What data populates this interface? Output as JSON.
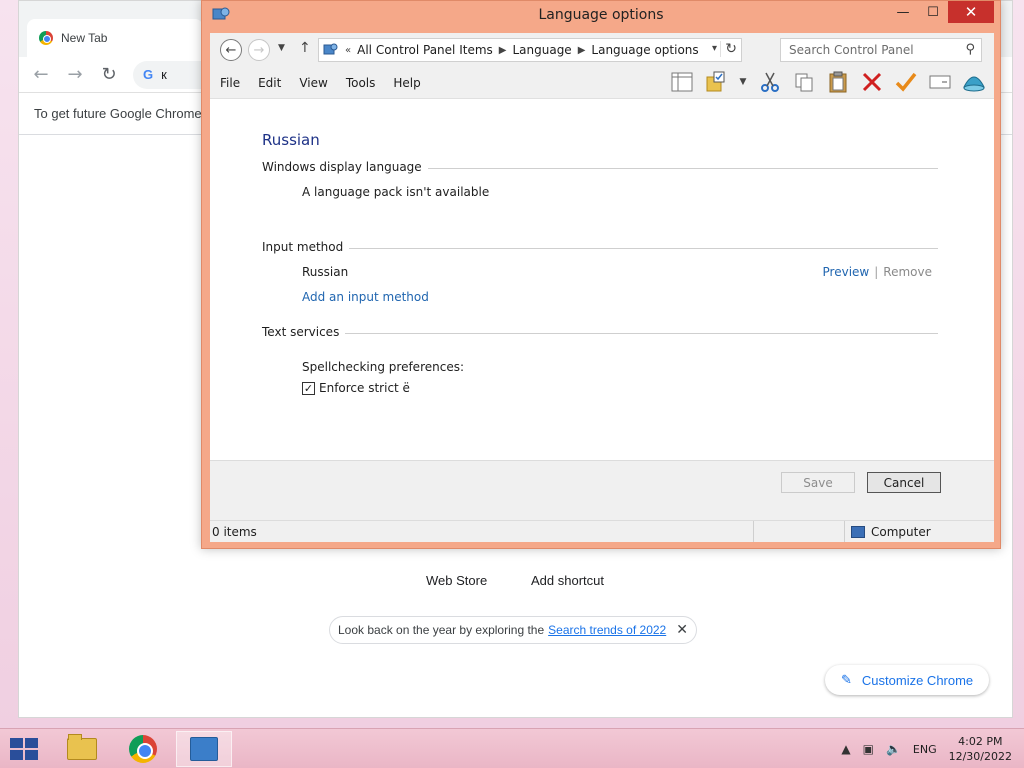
{
  "chrome": {
    "tab_title": "New Tab",
    "omnibox_text": "к",
    "infobar_text": "To get future Google Chrome",
    "ntp_links": [
      "Web Store",
      "Add shortcut"
    ],
    "trend_prefix": "Look back on the year by exploring the ",
    "trend_link": "Search trends of 2022",
    "customize_label": "Customize Chrome"
  },
  "window": {
    "title": "Language options",
    "caption": {
      "minimize": "—",
      "maximize": "☐",
      "close": "✕"
    },
    "address": {
      "overflow": "«",
      "crumbs": [
        "All Control Panel Items",
        "Language",
        "Language options"
      ]
    },
    "search_placeholder": "Search Control Panel",
    "menu": [
      "File",
      "Edit",
      "View",
      "Tools",
      "Help"
    ],
    "toolbar_icons": [
      "layout-icon",
      "properties-folder-icon",
      "cut-icon",
      "copy-icon",
      "paste-icon",
      "delete-icon",
      "check-icon",
      "rename-icon",
      "globe-icon"
    ]
  },
  "content": {
    "language_name": "Russian",
    "sections": {
      "display_language": "Windows display language",
      "input_method": "Input method",
      "text_services": "Text services"
    },
    "display_language_status": "A language pack isn't available",
    "input_method_name": "Russian",
    "preview_label": "Preview",
    "remove_label": "Remove",
    "add_input_label": "Add an input method",
    "spell_label": "Spellchecking preferences:",
    "checkbox_label": "Enforce strict ё",
    "checkbox_checked": true
  },
  "buttons": {
    "save": "Save",
    "cancel": "Cancel"
  },
  "status": {
    "items": "0 items",
    "location": "Computer"
  },
  "taskbar": {
    "lang": "ENG",
    "time": "4:02 PM",
    "date": "12/30/2022"
  }
}
